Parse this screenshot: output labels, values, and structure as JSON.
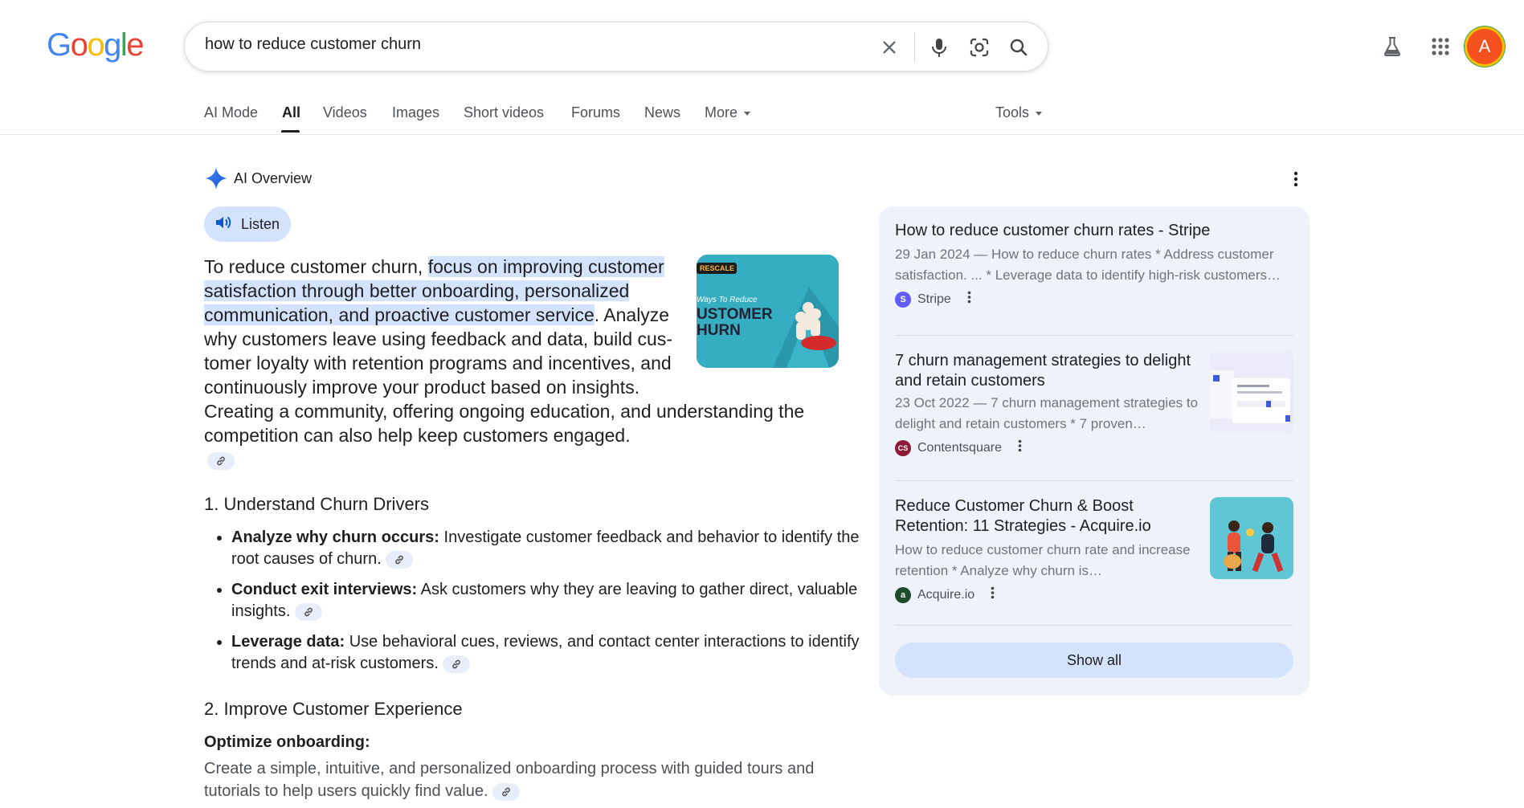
{
  "logo": "Google",
  "search": {
    "query": "how to reduce customer churn"
  },
  "avatar_letter": "A",
  "tabs": [
    {
      "label": "AI Mode"
    },
    {
      "label": "All"
    },
    {
      "label": "Videos"
    },
    {
      "label": "Images"
    },
    {
      "label": "Short videos"
    },
    {
      "label": "Forums"
    },
    {
      "label": "News"
    },
    {
      "label": "More"
    }
  ],
  "tools_label": "Tools",
  "ai_overview": {
    "title": "AI Overview",
    "listen_label": "Listen",
    "intro_plain": "To reduce customer churn, ",
    "intro_highlight": "focus on improving customer satisfaction through better onboarding, personalized communication, and proactive customer service",
    "intro_rest_a": ". Analyze why customers leave using feedback and data, build cus-tomer loyalty with retention programs and incentives, and continuously improve your product based on insights.",
    "intro_rest_b": "Creating a community, offering ongoing education, and understanding the competition can also help keep customers engaged.",
    "thumb_text_top": "RESCALE",
    "thumb_text_mid": "Ways To Reduce",
    "thumb_text_big1": "USTOMER",
    "thumb_text_big2": "HURN",
    "section1_title": "1. Understand Churn Drivers",
    "section1_items": [
      {
        "bold": "Analyze why churn occurs:",
        "text": " Investigate customer feedback and behavior to identify the root causes of churn."
      },
      {
        "bold": "Conduct exit interviews:",
        "text": " Ask customers why they are leaving to gather direct, valuable insights."
      },
      {
        "bold": "Leverage data:",
        "text": " Use behavioral cues, reviews, and contact center interactions to identify trends and at-risk customers."
      }
    ],
    "section2_title": "2. Improve Customer Experience",
    "section2_sub": "Optimize onboarding:",
    "section2_text": "Create a simple, intuitive, and personalized onboarding process with guided tours and tutorials to help users quickly find value."
  },
  "sources": [
    {
      "title": "How to reduce customer churn rates - Stripe",
      "snippet": "29 Jan 2024 — How to reduce churn rates * Address customer satisfaction. ... * Leverage data to identify high-risk customers…",
      "site": "Stripe",
      "fav_letter": "S",
      "fav_color": "#635bff"
    },
    {
      "title": "7 churn management strategies to delight and retain customers",
      "snippet": "23 Oct 2022 — 7 churn management strategies to delight and retain customers * 7 proven…",
      "site": "Contentsquare",
      "fav_letter": "CS",
      "fav_color": "#8c1a38"
    },
    {
      "title": "Reduce Customer Churn & Boost Retention: 11 Strategies - Acquire.io",
      "snippet": "How to reduce customer churn rate and increase retention * Analyze why churn is…",
      "site": "Acquire.io",
      "fav_letter": "a",
      "fav_color": "#1e4d2b"
    }
  ],
  "show_all_label": "Show all"
}
